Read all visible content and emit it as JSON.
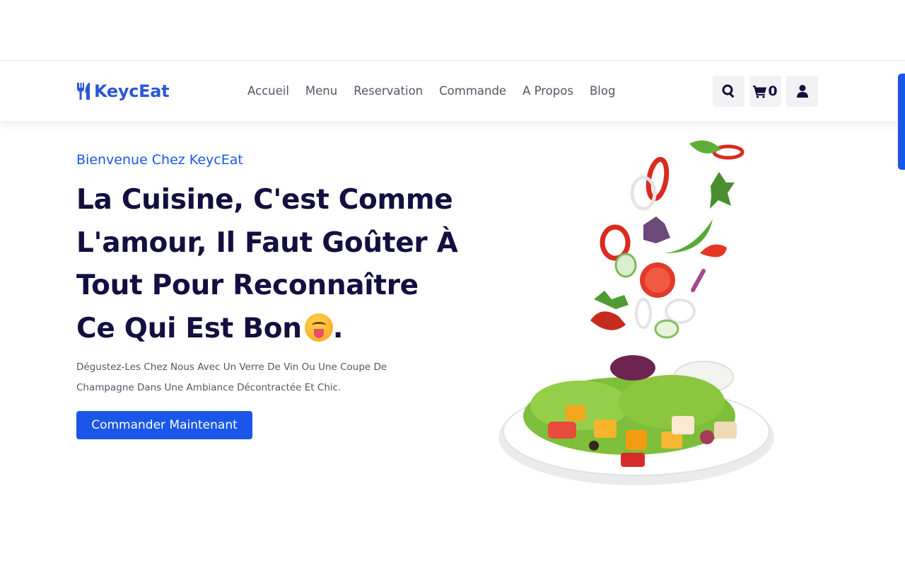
{
  "header": {
    "logo_text": "KeycEat",
    "nav": [
      "Accueil",
      "Menu",
      "Reservation",
      "Commande",
      "A Propos",
      "Blog"
    ],
    "cart_count": "0"
  },
  "hero": {
    "subtitle": "Bienvenue Chez KeycEat",
    "title": "La Cuisine, C'est Comme L'amour, Il Faut Goûter À Tout Pour Reconnaître Ce Qui Est Bon",
    "title_end": ".",
    "description": "Dégustez-Les Chez Nous Avec Un Verre De Vin Ou Une Coupe De Champagne Dans Une Ambiance Décontractée Et Chic.",
    "cta_label": "Commander Maintenant"
  },
  "icons": {
    "logo": "utensils-icon",
    "search": "search-icon",
    "cart": "cart-icon",
    "user": "user-icon",
    "emoji": "face-savoring-food-emoji"
  },
  "colors": {
    "accent": "#1a57e8",
    "logo": "#2b57d6",
    "heading": "#130f40",
    "text": "#555566"
  }
}
